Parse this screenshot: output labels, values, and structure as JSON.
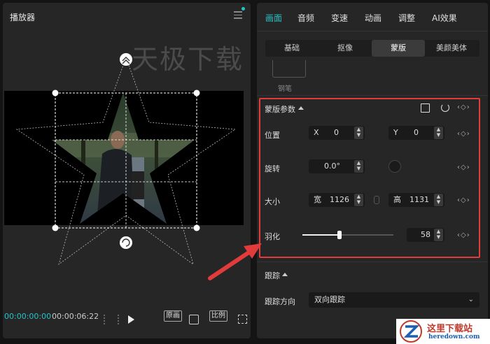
{
  "player": {
    "title": "播放器",
    "watermark": "天极下载",
    "time_current": "00:00:00:00",
    "time_total": "00:00:06:22",
    "btn_original": "原画",
    "btn_ratio": "比例"
  },
  "props": {
    "tabs": [
      "画面",
      "音频",
      "变速",
      "动画",
      "调整",
      "AI效果"
    ],
    "subtabs": [
      "基础",
      "抠像",
      "蒙版",
      "美颜美体"
    ],
    "pen_label": "钢笔",
    "mask_section": "蒙版参数",
    "position_label": "位置",
    "x_prefix": "X",
    "x_value": "0",
    "y_prefix": "Y",
    "y_value": "0",
    "rotate_label": "旋转",
    "rotate_value": "0.0°",
    "size_label": "大小",
    "width_prefix": "宽",
    "width_value": "1126",
    "height_prefix": "高",
    "height_value": "1131",
    "feather_label": "羽化",
    "feather_value": "58",
    "feather_fraction": 0.41,
    "track_section": "跟踪",
    "track_dir_label": "跟踪方向",
    "track_dir_value": "双向跟踪"
  },
  "logo": {
    "title": "这里下载站",
    "url": "heredown.com"
  },
  "colors": {
    "accent": "#29c2c7",
    "highlight": "#e23b3b"
  }
}
